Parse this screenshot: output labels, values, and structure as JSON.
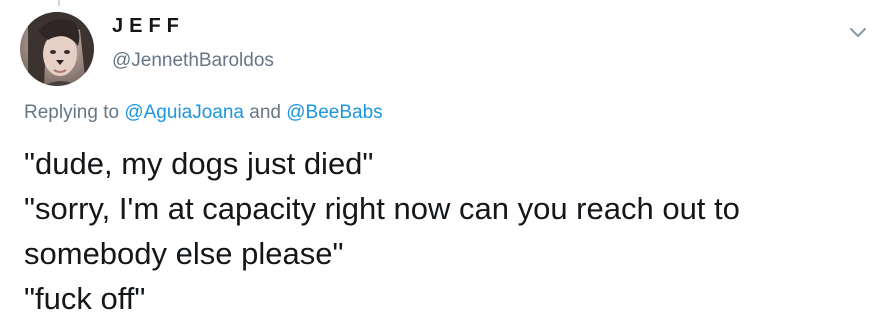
{
  "author": {
    "display_name": "JEFF",
    "handle": "@JennethBaroldos"
  },
  "reply": {
    "prefix": "Replying to ",
    "mention_1": "@AguiaJoana",
    "conjunction": " and ",
    "mention_2": "@BeeBabs"
  },
  "tweet": {
    "lines": [
      "\"dude, my dogs just died\"",
      "\"sorry, I'm at capacity right now can you reach out to",
      "somebody else please\"",
      "\"fuck off\""
    ]
  },
  "icons": {
    "menu": "chevron-down-icon"
  },
  "colors": {
    "text": "#14171a",
    "secondary": "#657786",
    "link": "#1b95e0",
    "thread": "#ccd6dd"
  }
}
